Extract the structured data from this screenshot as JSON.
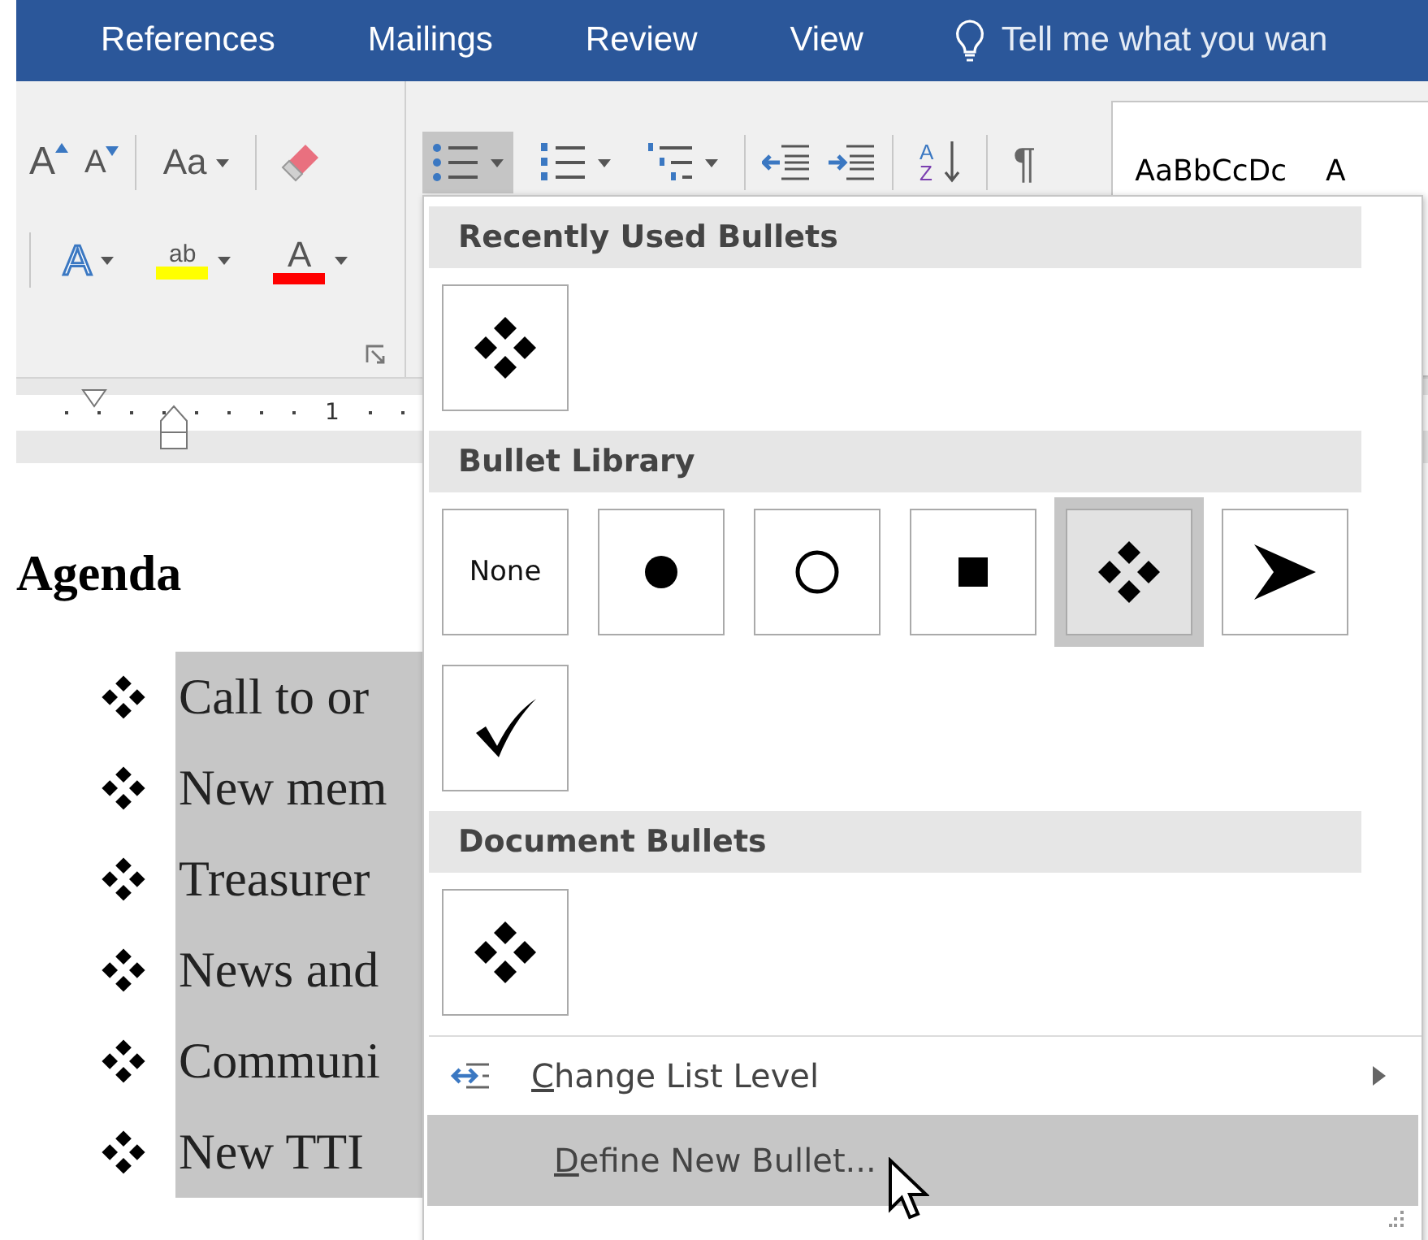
{
  "ribbon_tabs": [
    {
      "label": "References"
    },
    {
      "label": "Mailings"
    },
    {
      "label": "Review"
    },
    {
      "label": "View"
    }
  ],
  "tell_me": {
    "placeholder": "Tell me what you wan"
  },
  "toolbar": {
    "grow_font": "A",
    "shrink_font": "A",
    "change_case": "Aa",
    "bullets_selected": true,
    "sort_top": "A",
    "sort_bottom": "Z",
    "pilcrow": "¶",
    "text_effects": "A",
    "highlight": "ab",
    "font_color": "A"
  },
  "styles": {
    "sample": "AaBbCcDc",
    "next_sample": "A"
  },
  "ruler": {
    "mark": "1"
  },
  "document": {
    "heading": "Agenda",
    "items": [
      {
        "text": "Call to or"
      },
      {
        "text": "New mem"
      },
      {
        "text": "Treasurer"
      },
      {
        "text": "News and"
      },
      {
        "text": "Communi"
      },
      {
        "text": "New TTI"
      }
    ]
  },
  "menu": {
    "sections": [
      {
        "title": "Recently Used Bullets",
        "bullets": [
          {
            "kind": "diamonds",
            "selected": false
          }
        ]
      },
      {
        "title": "Bullet Library",
        "bullets": [
          {
            "kind": "none",
            "label": "None",
            "selected": false
          },
          {
            "kind": "dot",
            "selected": false
          },
          {
            "kind": "circle",
            "selected": false
          },
          {
            "kind": "square",
            "selected": false
          },
          {
            "kind": "diamonds",
            "selected": true
          },
          {
            "kind": "arrow",
            "selected": false
          },
          {
            "kind": "check",
            "selected": false
          }
        ]
      },
      {
        "title": "Document Bullets",
        "bullets": [
          {
            "kind": "diamonds",
            "selected": false
          }
        ]
      }
    ],
    "commands": [
      {
        "label": "Change List Level",
        "kind": "submenu",
        "selected": false
      },
      {
        "label": "Define New Bullet...",
        "kind": "plain",
        "selected": true
      }
    ]
  }
}
